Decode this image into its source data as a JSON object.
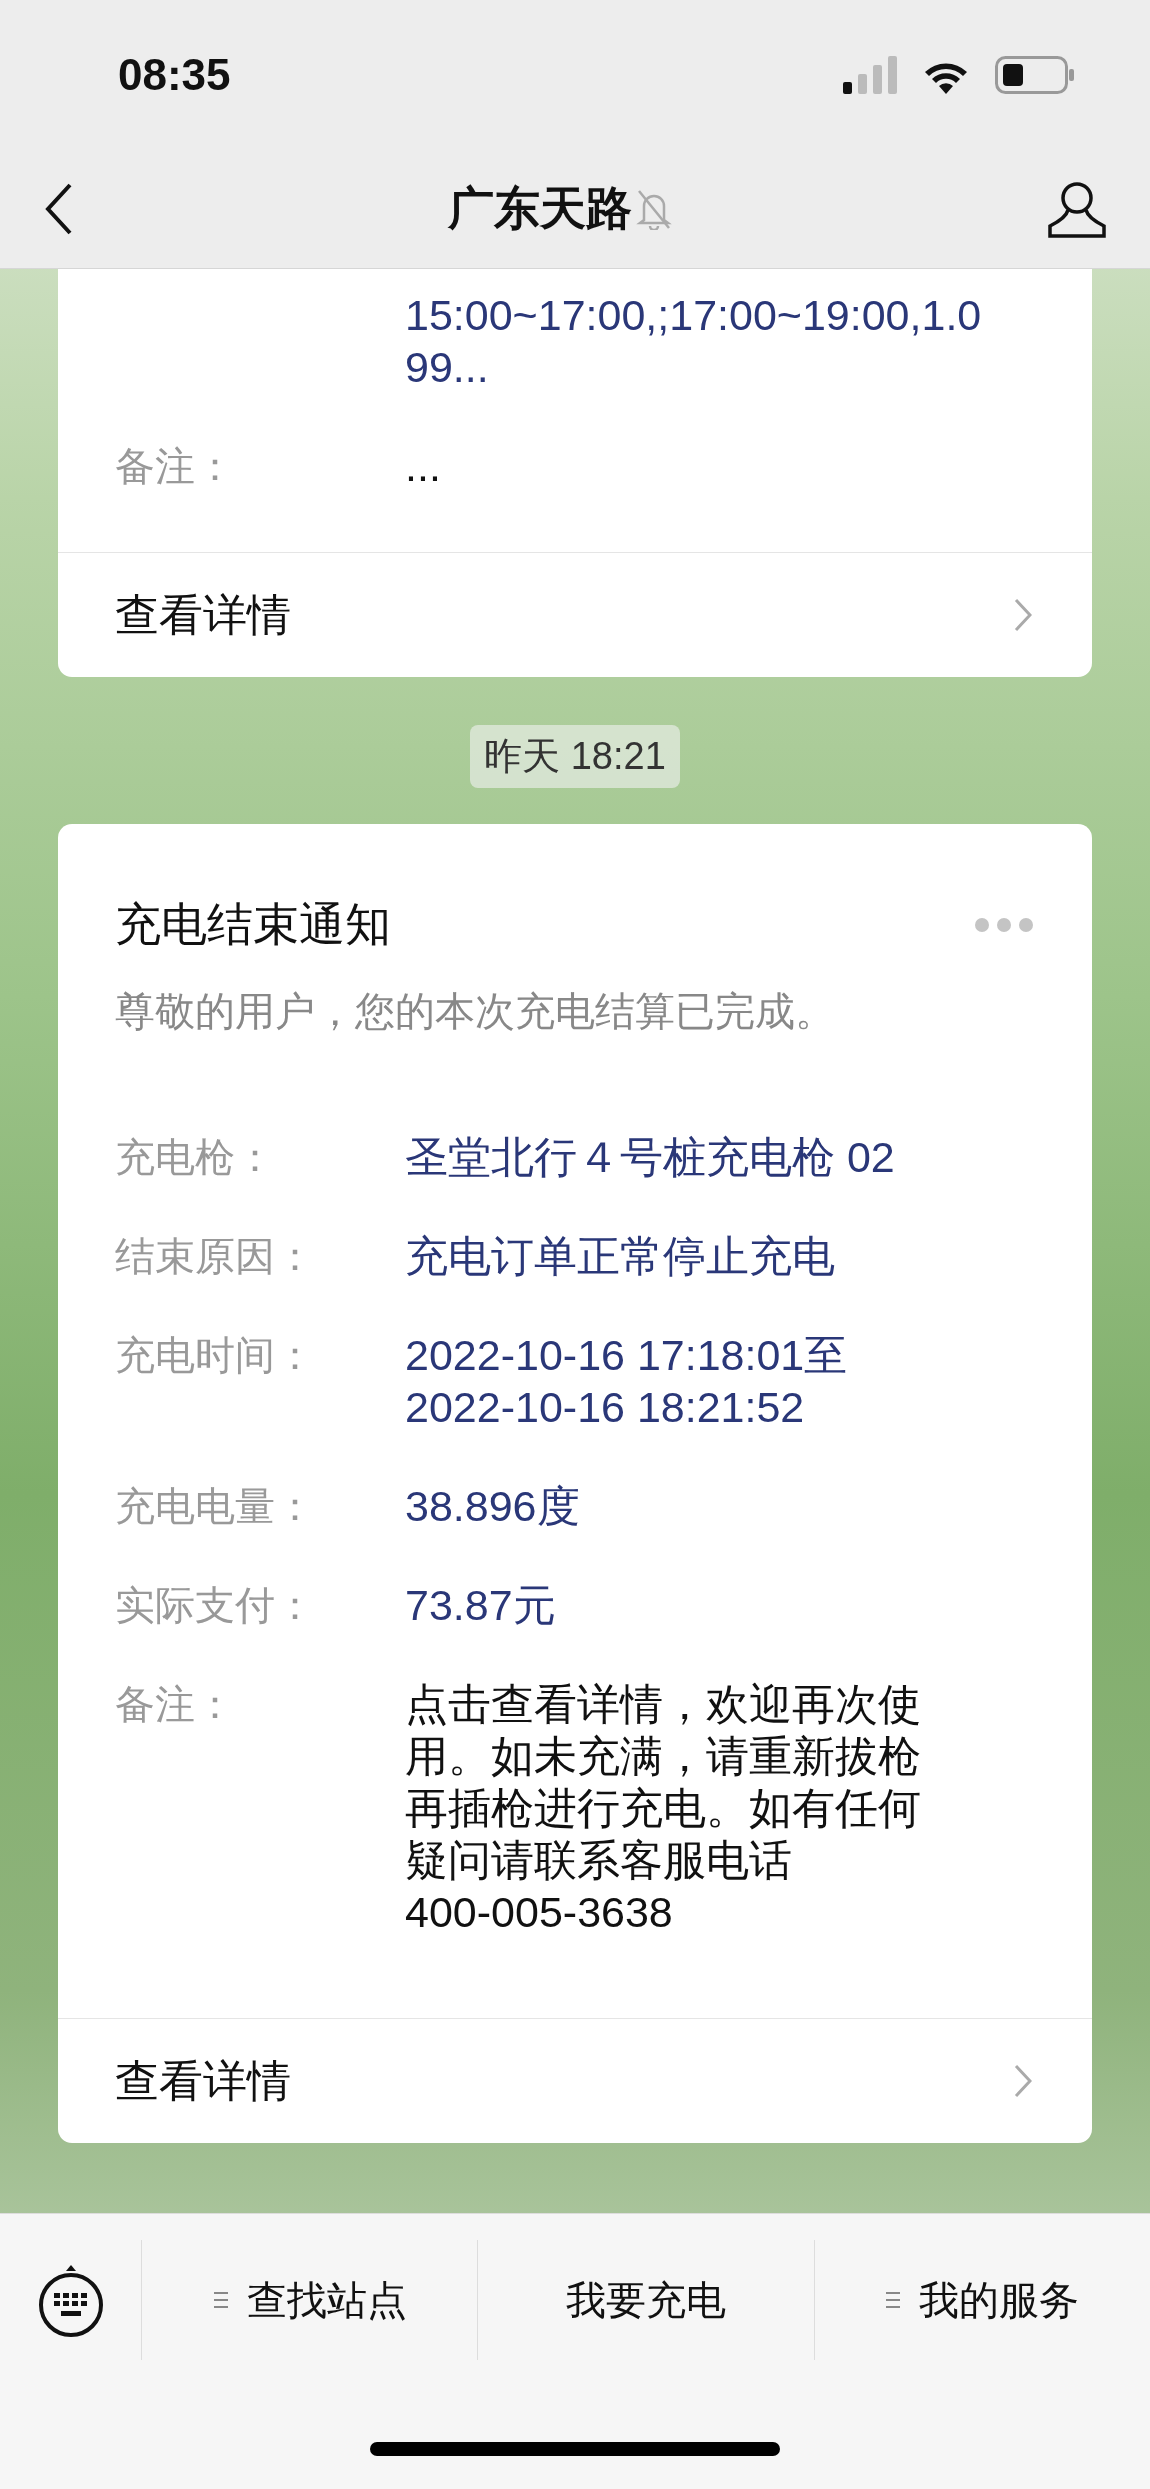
{
  "status_bar": {
    "time": "08:35"
  },
  "nav": {
    "title": "广东天路",
    "muted": true
  },
  "messages": [
    {
      "kind": "card",
      "fields": [
        {
          "value": "15:00~17:00,;17:00~19:00,1.0\n99..."
        },
        {
          "label": "备注：",
          "value": "..."
        }
      ],
      "link": "查看详情"
    },
    {
      "kind": "time",
      "text": "昨天 18:21"
    },
    {
      "kind": "card",
      "title": "充电结束通知",
      "subtitle": "尊敬的用户，您的本次充电结算已完成。",
      "fields": [
        {
          "label": "充电枪：",
          "value": "圣堂北行４号桩充电枪 02"
        },
        {
          "label": "结束原因：",
          "value": "充电订单正常停止充电"
        },
        {
          "label": "充电时间：",
          "value": "2022-10-16 17:18:01至\n2022-10-16 18:21:52"
        },
        {
          "label": "充电电量：",
          "value": "38.896度"
        },
        {
          "label": "实际支付：",
          "value": "73.87元"
        },
        {
          "label": "备注：",
          "value": "点击查看详情，欢迎再次使用。如未充满，请重新拔枪再插枪进行充电。如有任何疑问请联系客服电话\n400-005-3638"
        }
      ],
      "link": "查看详情"
    }
  ],
  "menu": [
    {
      "label": "查找站点",
      "submenu": true
    },
    {
      "label": "我要充电",
      "submenu": false
    },
    {
      "label": "我的服务",
      "submenu": true
    }
  ]
}
